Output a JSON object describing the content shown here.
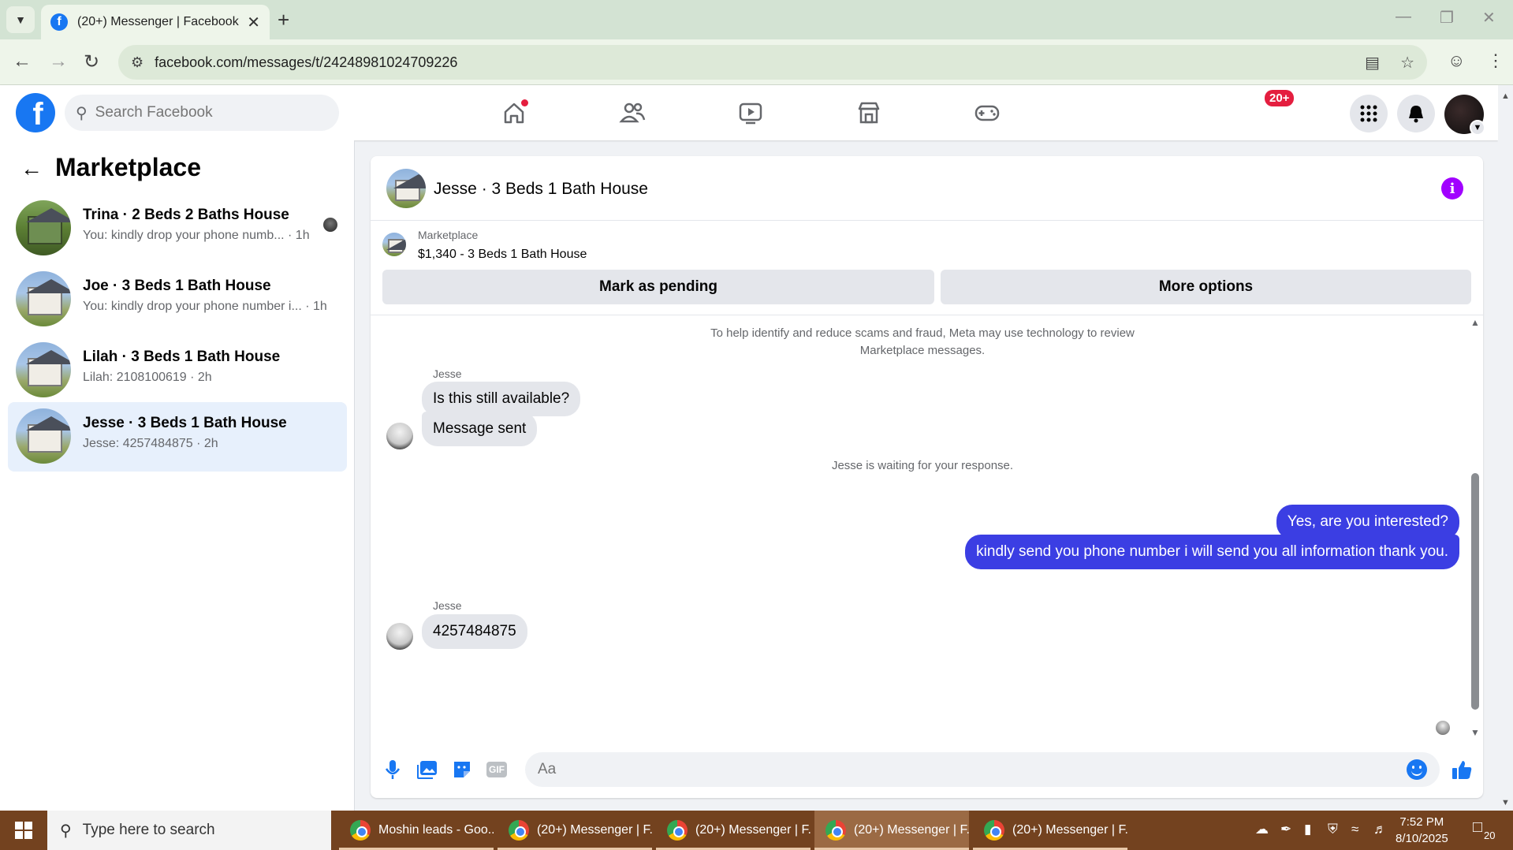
{
  "browser": {
    "tab_title": "(20+) Messenger | Facebook",
    "url": "facebook.com/messages/t/24248981024709226"
  },
  "fb": {
    "search_placeholder": "Search Facebook",
    "notification_count": "20+"
  },
  "sidebar": {
    "title": "Marketplace",
    "conversations": [
      {
        "name": "Trina · 2 Beds 2 Baths House",
        "preview": "You: kindly drop your phone numb... · 1h",
        "active": false
      },
      {
        "name": "Joe · 3 Beds 1 Bath House",
        "preview": "You: kindly drop your phone number i... · 1h",
        "active": false
      },
      {
        "name": "Lilah · 3 Beds 1 Bath House",
        "preview": "Lilah: 2108100619 · 2h",
        "active": false
      },
      {
        "name": "Jesse · 3 Beds 1 Bath House",
        "preview": "Jesse: 4257484875 · 2h",
        "active": true
      }
    ]
  },
  "chat": {
    "title": "Jesse · 3 Beds 1 Bath House",
    "listing_label": "Marketplace",
    "listing_price": "$1,340 - 3 Beds 1 Bath House",
    "mark_pending_label": "Mark as pending",
    "more_options_label": "More options",
    "notice_line1": "To help identify and reduce scams and fraud, Meta may use technology to review",
    "notice_line2": "Marketplace messages.",
    "sender1": "Jesse",
    "msg_in_1": "Is this still available?",
    "msg_in_2": "Message sent",
    "waiting": "Jesse is waiting for your response.",
    "msg_out_1": "Yes, are you interested?",
    "msg_out_2": "kindly send you phone number i will send you all information thank you.",
    "sender2": "Jesse",
    "msg_in_3": "4257484875",
    "composer_placeholder": "Aa",
    "gif_label": "GIF"
  },
  "taskbar": {
    "search_placeholder": "Type here to search",
    "apps": [
      {
        "label": "Moshin leads - Goo...",
        "active": false
      },
      {
        "label": "(20+) Messenger | F...",
        "active": false
      },
      {
        "label": "(20+) Messenger | F...",
        "active": false
      },
      {
        "label": "(20+) Messenger | F...",
        "active": true
      },
      {
        "label": "(20+) Messenger | F...",
        "active": false
      }
    ],
    "time": "7:52 PM",
    "date": "8/10/2025",
    "notif_count": "20"
  }
}
